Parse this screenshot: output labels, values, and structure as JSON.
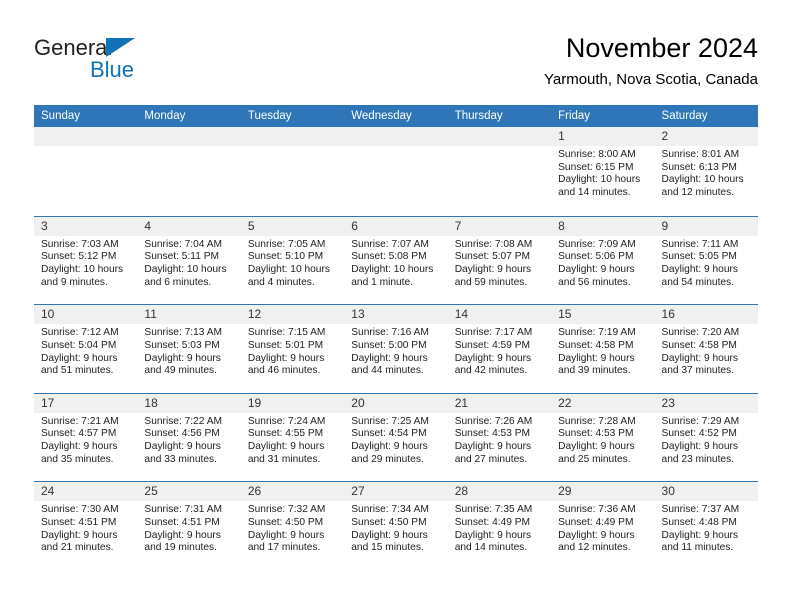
{
  "brand": {
    "name_part1": "General",
    "name_part2": "Blue",
    "triangle_icon": "triangle-icon",
    "accent_color": "#1272b8"
  },
  "header": {
    "title": "November 2024",
    "subtitle": "Yarmouth, Nova Scotia, Canada"
  },
  "calendar": {
    "header_bg": "#2f76b8",
    "daynum_bg": "#f0f0f0",
    "weekdays": [
      "Sunday",
      "Monday",
      "Tuesday",
      "Wednesday",
      "Thursday",
      "Friday",
      "Saturday"
    ],
    "weeks": [
      [
        {
          "day": "",
          "empty": true
        },
        {
          "day": "",
          "empty": true
        },
        {
          "day": "",
          "empty": true
        },
        {
          "day": "",
          "empty": true
        },
        {
          "day": "",
          "empty": true
        },
        {
          "day": "1",
          "sunrise": "Sunrise: 8:00 AM",
          "sunset": "Sunset: 6:15 PM",
          "daylight": "Daylight: 10 hours and 14 minutes."
        },
        {
          "day": "2",
          "sunrise": "Sunrise: 8:01 AM",
          "sunset": "Sunset: 6:13 PM",
          "daylight": "Daylight: 10 hours and 12 minutes."
        }
      ],
      [
        {
          "day": "3",
          "sunrise": "Sunrise: 7:03 AM",
          "sunset": "Sunset: 5:12 PM",
          "daylight": "Daylight: 10 hours and 9 minutes."
        },
        {
          "day": "4",
          "sunrise": "Sunrise: 7:04 AM",
          "sunset": "Sunset: 5:11 PM",
          "daylight": "Daylight: 10 hours and 6 minutes."
        },
        {
          "day": "5",
          "sunrise": "Sunrise: 7:05 AM",
          "sunset": "Sunset: 5:10 PM",
          "daylight": "Daylight: 10 hours and 4 minutes."
        },
        {
          "day": "6",
          "sunrise": "Sunrise: 7:07 AM",
          "sunset": "Sunset: 5:08 PM",
          "daylight": "Daylight: 10 hours and 1 minute."
        },
        {
          "day": "7",
          "sunrise": "Sunrise: 7:08 AM",
          "sunset": "Sunset: 5:07 PM",
          "daylight": "Daylight: 9 hours and 59 minutes."
        },
        {
          "day": "8",
          "sunrise": "Sunrise: 7:09 AM",
          "sunset": "Sunset: 5:06 PM",
          "daylight": "Daylight: 9 hours and 56 minutes."
        },
        {
          "day": "9",
          "sunrise": "Sunrise: 7:11 AM",
          "sunset": "Sunset: 5:05 PM",
          "daylight": "Daylight: 9 hours and 54 minutes."
        }
      ],
      [
        {
          "day": "10",
          "sunrise": "Sunrise: 7:12 AM",
          "sunset": "Sunset: 5:04 PM",
          "daylight": "Daylight: 9 hours and 51 minutes."
        },
        {
          "day": "11",
          "sunrise": "Sunrise: 7:13 AM",
          "sunset": "Sunset: 5:03 PM",
          "daylight": "Daylight: 9 hours and 49 minutes."
        },
        {
          "day": "12",
          "sunrise": "Sunrise: 7:15 AM",
          "sunset": "Sunset: 5:01 PM",
          "daylight": "Daylight: 9 hours and 46 minutes."
        },
        {
          "day": "13",
          "sunrise": "Sunrise: 7:16 AM",
          "sunset": "Sunset: 5:00 PM",
          "daylight": "Daylight: 9 hours and 44 minutes."
        },
        {
          "day": "14",
          "sunrise": "Sunrise: 7:17 AM",
          "sunset": "Sunset: 4:59 PM",
          "daylight": "Daylight: 9 hours and 42 minutes."
        },
        {
          "day": "15",
          "sunrise": "Sunrise: 7:19 AM",
          "sunset": "Sunset: 4:58 PM",
          "daylight": "Daylight: 9 hours and 39 minutes."
        },
        {
          "day": "16",
          "sunrise": "Sunrise: 7:20 AM",
          "sunset": "Sunset: 4:58 PM",
          "daylight": "Daylight: 9 hours and 37 minutes."
        }
      ],
      [
        {
          "day": "17",
          "sunrise": "Sunrise: 7:21 AM",
          "sunset": "Sunset: 4:57 PM",
          "daylight": "Daylight: 9 hours and 35 minutes."
        },
        {
          "day": "18",
          "sunrise": "Sunrise: 7:22 AM",
          "sunset": "Sunset: 4:56 PM",
          "daylight": "Daylight: 9 hours and 33 minutes."
        },
        {
          "day": "19",
          "sunrise": "Sunrise: 7:24 AM",
          "sunset": "Sunset: 4:55 PM",
          "daylight": "Daylight: 9 hours and 31 minutes."
        },
        {
          "day": "20",
          "sunrise": "Sunrise: 7:25 AM",
          "sunset": "Sunset: 4:54 PM",
          "daylight": "Daylight: 9 hours and 29 minutes."
        },
        {
          "day": "21",
          "sunrise": "Sunrise: 7:26 AM",
          "sunset": "Sunset: 4:53 PM",
          "daylight": "Daylight: 9 hours and 27 minutes."
        },
        {
          "day": "22",
          "sunrise": "Sunrise: 7:28 AM",
          "sunset": "Sunset: 4:53 PM",
          "daylight": "Daylight: 9 hours and 25 minutes."
        },
        {
          "day": "23",
          "sunrise": "Sunrise: 7:29 AM",
          "sunset": "Sunset: 4:52 PM",
          "daylight": "Daylight: 9 hours and 23 minutes."
        }
      ],
      [
        {
          "day": "24",
          "sunrise": "Sunrise: 7:30 AM",
          "sunset": "Sunset: 4:51 PM",
          "daylight": "Daylight: 9 hours and 21 minutes."
        },
        {
          "day": "25",
          "sunrise": "Sunrise: 7:31 AM",
          "sunset": "Sunset: 4:51 PM",
          "daylight": "Daylight: 9 hours and 19 minutes."
        },
        {
          "day": "26",
          "sunrise": "Sunrise: 7:32 AM",
          "sunset": "Sunset: 4:50 PM",
          "daylight": "Daylight: 9 hours and 17 minutes."
        },
        {
          "day": "27",
          "sunrise": "Sunrise: 7:34 AM",
          "sunset": "Sunset: 4:50 PM",
          "daylight": "Daylight: 9 hours and 15 minutes."
        },
        {
          "day": "28",
          "sunrise": "Sunrise: 7:35 AM",
          "sunset": "Sunset: 4:49 PM",
          "daylight": "Daylight: 9 hours and 14 minutes."
        },
        {
          "day": "29",
          "sunrise": "Sunrise: 7:36 AM",
          "sunset": "Sunset: 4:49 PM",
          "daylight": "Daylight: 9 hours and 12 minutes."
        },
        {
          "day": "30",
          "sunrise": "Sunrise: 7:37 AM",
          "sunset": "Sunset: 4:48 PM",
          "daylight": "Daylight: 9 hours and 11 minutes."
        }
      ]
    ]
  }
}
